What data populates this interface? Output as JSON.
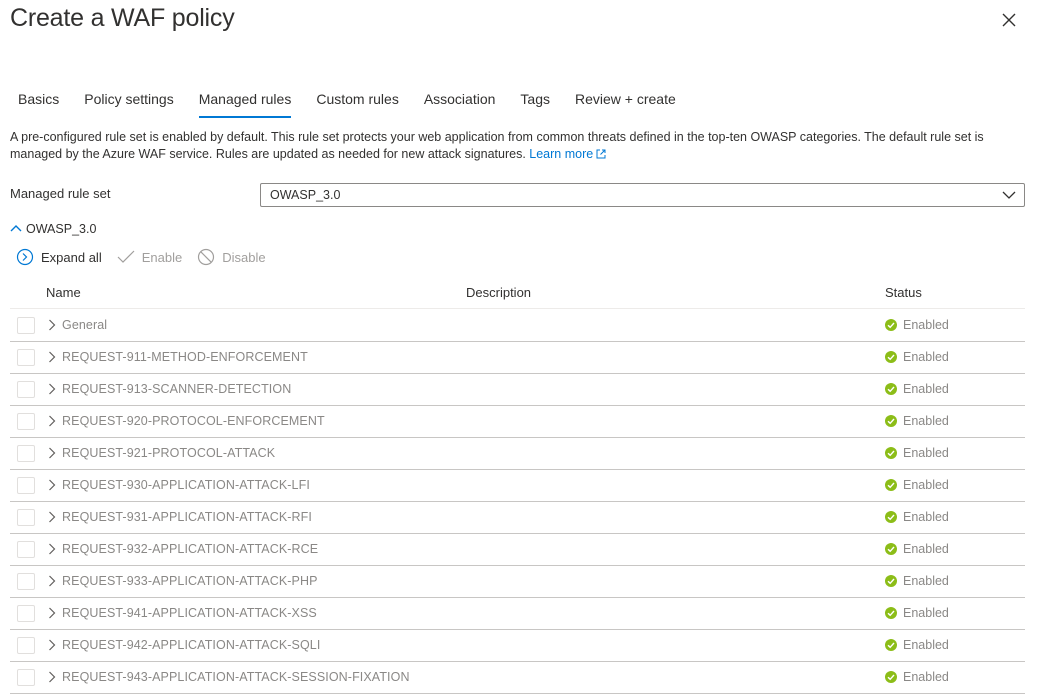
{
  "header": {
    "title": "Create a WAF policy"
  },
  "tabs": [
    {
      "label": "Basics",
      "active": false
    },
    {
      "label": "Policy settings",
      "active": false
    },
    {
      "label": "Managed rules",
      "active": true
    },
    {
      "label": "Custom rules",
      "active": false
    },
    {
      "label": "Association",
      "active": false
    },
    {
      "label": "Tags",
      "active": false
    },
    {
      "label": "Review + create",
      "active": false
    }
  ],
  "description": {
    "text": "A pre-configured rule set is enabled by default. This rule set protects your web application from common threats defined in the top-ten OWASP categories. The default rule set is managed by the Azure WAF service. Rules are updated as needed for new attack signatures.",
    "link": "Learn more"
  },
  "rule_set": {
    "label": "Managed rule set",
    "value": "OWASP_3.0"
  },
  "group": {
    "label": "OWASP_3.0"
  },
  "commands": {
    "expand_all": "Expand all",
    "enable": "Enable",
    "disable": "Disable"
  },
  "table": {
    "columns": {
      "name": "Name",
      "description": "Description",
      "status": "Status"
    },
    "rows": [
      {
        "name": "General",
        "status": "Enabled"
      },
      {
        "name": "REQUEST-911-METHOD-ENFORCEMENT",
        "status": "Enabled"
      },
      {
        "name": "REQUEST-913-SCANNER-DETECTION",
        "status": "Enabled"
      },
      {
        "name": "REQUEST-920-PROTOCOL-ENFORCEMENT",
        "status": "Enabled"
      },
      {
        "name": "REQUEST-921-PROTOCOL-ATTACK",
        "status": "Enabled"
      },
      {
        "name": "REQUEST-930-APPLICATION-ATTACK-LFI",
        "status": "Enabled"
      },
      {
        "name": "REQUEST-931-APPLICATION-ATTACK-RFI",
        "status": "Enabled"
      },
      {
        "name": "REQUEST-932-APPLICATION-ATTACK-RCE",
        "status": "Enabled"
      },
      {
        "name": "REQUEST-933-APPLICATION-ATTACK-PHP",
        "status": "Enabled"
      },
      {
        "name": "REQUEST-941-APPLICATION-ATTACK-XSS",
        "status": "Enabled"
      },
      {
        "name": "REQUEST-942-APPLICATION-ATTACK-SQLI",
        "status": "Enabled"
      },
      {
        "name": "REQUEST-943-APPLICATION-ATTACK-SESSION-FIXATION",
        "status": "Enabled"
      }
    ]
  },
  "colors": {
    "accent": "#0078d4",
    "success": "#8cbd18",
    "muted_text": "#8a8886"
  },
  "icons": {
    "close": "close-icon",
    "external_link": "external-link-icon",
    "dropdown": "chevron-down-icon",
    "group_toggle": "chevron-up-icon",
    "expand_all": "expand-circle-icon",
    "enable": "checkmark-icon",
    "disable": "block-icon",
    "row_expander": "chevron-right-icon",
    "status_enabled": "success-check-circle-icon"
  }
}
